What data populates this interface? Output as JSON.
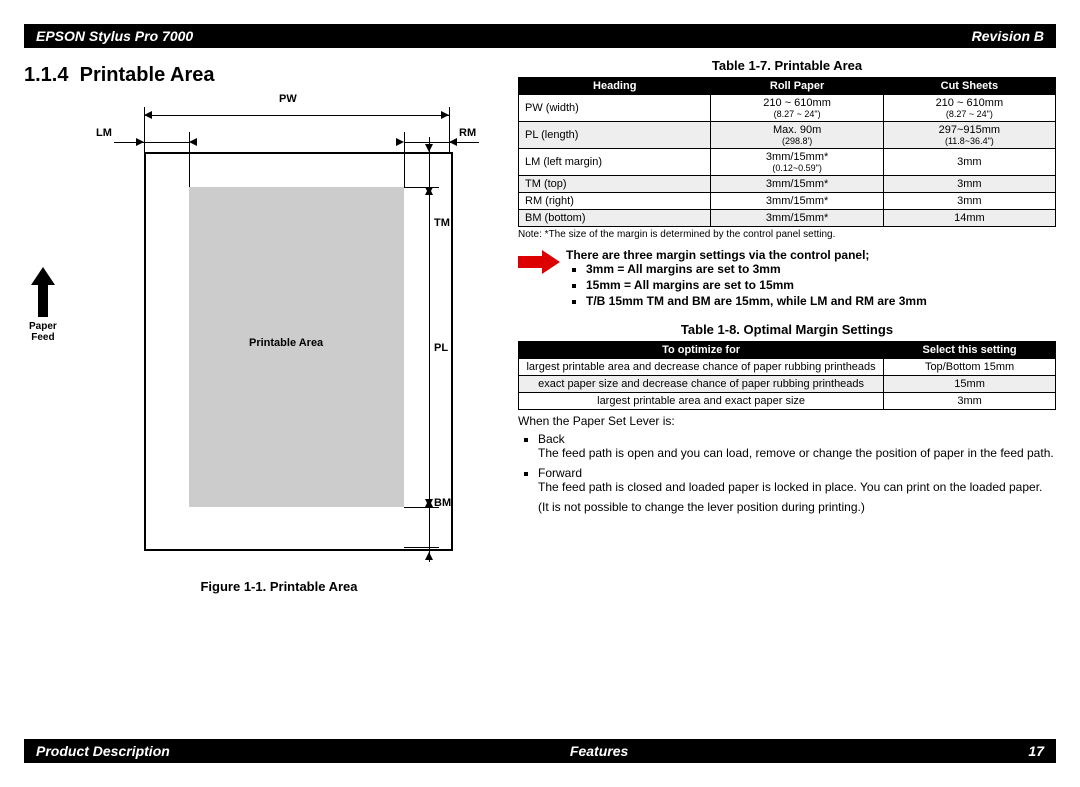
{
  "header": {
    "left": "EPSON Stylus Pro 7000",
    "right": "Revision B"
  },
  "section": {
    "number": "1.1.4",
    "title": "Printable Area"
  },
  "figure": {
    "pw": "PW",
    "lm": "LM",
    "rm": "RM",
    "tm": "TM",
    "pl": "PL",
    "bm": "BM",
    "printable": "Printable Area",
    "paper_feed": "Paper",
    "paper_feed2": "Feed",
    "caption": "Figure 1-1.  Printable Area"
  },
  "table7": {
    "caption": "Table 1-7.  Printable Area",
    "headers": [
      "Heading",
      "Roll Paper",
      "Cut Sheets"
    ],
    "rows": [
      {
        "h": "PW (width)",
        "r": "210 ~ 610mm",
        "r2": "(8.27 ~ 24\")",
        "c": "210 ~ 610mm",
        "c2": "(8.27 ~ 24\")"
      },
      {
        "h": "PL (length)",
        "r": "Max. 90m",
        "r2": "(298.8')",
        "c": "297~915mm",
        "c2": "(11.8~36.4\")"
      },
      {
        "h": "LM (left margin)",
        "r": "3mm/15mm*",
        "r2": "(0.12~0.59\")",
        "c": "3mm",
        "c2": ""
      },
      {
        "h": "TM (top)",
        "r": "3mm/15mm*",
        "r2": "",
        "c": "3mm",
        "c2": ""
      },
      {
        "h": "RM (right)",
        "r": "3mm/15mm*",
        "r2": "",
        "c": "3mm",
        "c2": ""
      },
      {
        "h": "BM (bottom)",
        "r": "3mm/15mm*",
        "r2": "",
        "c": "14mm",
        "c2": ""
      }
    ],
    "note": "Note: *The size of the margin is determined by the control panel setting."
  },
  "margin_block": {
    "intro": "There are three margin settings via the control panel;",
    "b1": "3mm = All margins are set to 3mm",
    "b2": "15mm = All margins are set to 15mm",
    "b3": "T/B 15mm TM and BM are 15mm, while LM and RM are 3mm"
  },
  "table8": {
    "caption": "Table 1-8.  Optimal Margin Settings",
    "headers": [
      "To optimize for",
      "Select this setting"
    ],
    "rows": [
      {
        "a": "largest printable area and decrease chance of paper rubbing printheads",
        "b": "Top/Bottom 15mm"
      },
      {
        "a": "exact paper size and decrease chance of paper rubbing printheads",
        "b": "15mm"
      },
      {
        "a": "largest printable area and exact paper size",
        "b": "3mm"
      }
    ]
  },
  "lever": {
    "intro": "When the Paper Set Lever is:",
    "back_label": "Back",
    "back_text": "The feed path is open and you can load, remove or change the position of paper in the feed path.",
    "forward_label": "Forward",
    "forward_text": "The feed path is closed and loaded paper is locked in place. You can print on the loaded paper.",
    "forward_text2": "(It is not possible to change the lever position during printing.)"
  },
  "footer": {
    "left": "Product Description",
    "center": "Features",
    "right": "17"
  }
}
